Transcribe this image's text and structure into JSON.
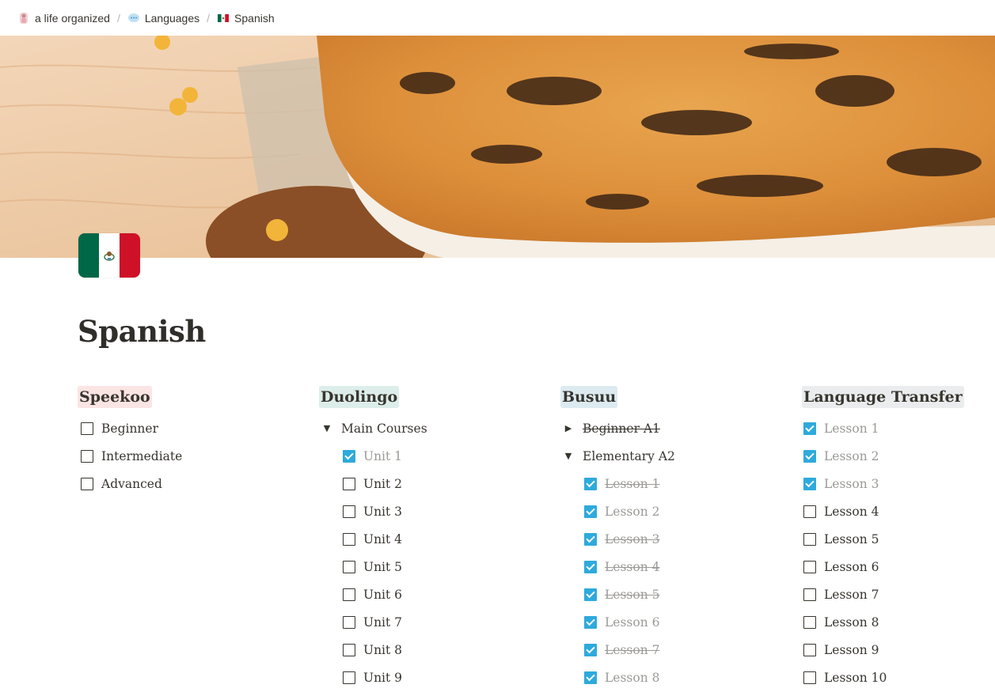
{
  "breadcrumb": [
    {
      "label": "a life organized",
      "icon": "avatar-icon"
    },
    {
      "label": "Languages",
      "icon": "speech-bubble-icon"
    },
    {
      "label": "Spanish",
      "icon": "mexico-flag-icon"
    }
  ],
  "page": {
    "title": "Spanish",
    "icon": "mexico-flag-icon"
  },
  "colors": {
    "checkbox_checked": "#2eaadc",
    "speekoo_bg": "#fbe4e4",
    "duolingo_bg": "#ddedea",
    "busuu_bg": "#ddebf1",
    "language_transfer_bg": "#ebeced",
    "mexico_green": "#006847",
    "mexico_red": "#ce1126"
  },
  "columns": {
    "speekoo": {
      "heading": "Speekoo",
      "items": [
        {
          "label": "Beginner",
          "checked": false
        },
        {
          "label": "Intermediate",
          "checked": false
        },
        {
          "label": "Advanced",
          "checked": false
        }
      ]
    },
    "duolingo": {
      "heading": "Duolingo",
      "toggle": "Main Courses",
      "items": [
        {
          "label": "Unit 1",
          "checked": true
        },
        {
          "label": "Unit 2",
          "checked": false
        },
        {
          "label": "Unit 3",
          "checked": false
        },
        {
          "label": "Unit 4",
          "checked": false
        },
        {
          "label": "Unit 5",
          "checked": false
        },
        {
          "label": "Unit 6",
          "checked": false
        },
        {
          "label": "Unit 7",
          "checked": false
        },
        {
          "label": "Unit 8",
          "checked": false
        },
        {
          "label": "Unit 9",
          "checked": false
        }
      ]
    },
    "busuu": {
      "heading": "Busuu",
      "collapsed_toggle": "Beginner A1",
      "toggle": "Elementary A2",
      "items": [
        {
          "label": "Lesson 1",
          "checked": true
        },
        {
          "label": "Lesson 2",
          "checked": true
        },
        {
          "label": "Lesson 3",
          "checked": true
        },
        {
          "label": "Lesson 4",
          "checked": true
        },
        {
          "label": "Lesson 5",
          "checked": true
        },
        {
          "label": "Lesson 6",
          "checked": true
        },
        {
          "label": "Lesson 7",
          "checked": true
        },
        {
          "label": "Lesson 8",
          "checked": true
        }
      ]
    },
    "language_transfer": {
      "heading": "Language Transfer",
      "items": [
        {
          "label": "Lesson 1",
          "checked": true
        },
        {
          "label": "Lesson 2",
          "checked": true
        },
        {
          "label": "Lesson 3",
          "checked": true
        },
        {
          "label": "Lesson 4",
          "checked": false
        },
        {
          "label": "Lesson 5",
          "checked": false
        },
        {
          "label": "Lesson 6",
          "checked": false
        },
        {
          "label": "Lesson 7",
          "checked": false
        },
        {
          "label": "Lesson 8",
          "checked": false
        },
        {
          "label": "Lesson 9",
          "checked": false
        },
        {
          "label": "Lesson 10",
          "checked": false
        }
      ]
    }
  }
}
